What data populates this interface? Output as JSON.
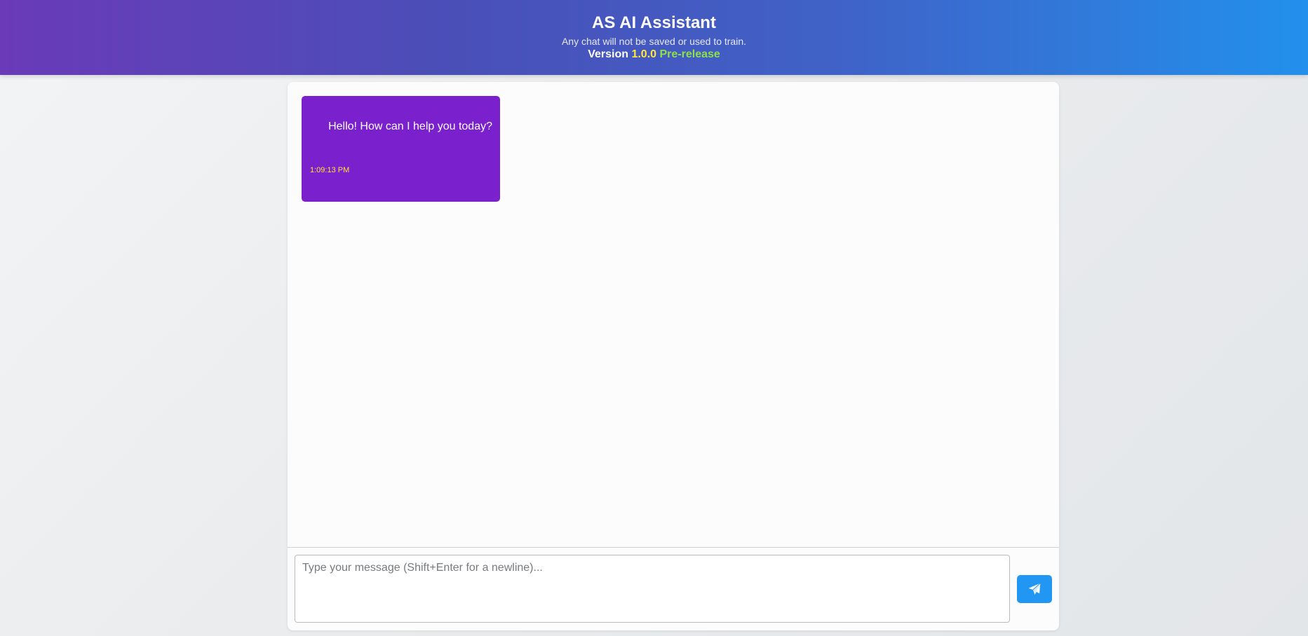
{
  "header": {
    "title": "AS AI Assistant",
    "subtitle": "Any chat will not be saved or used to train.",
    "version_label": "Version",
    "version_number": "1.0.0",
    "version_tag": "Pre-release"
  },
  "messages": [
    {
      "text": "Hello! How can I help you today?",
      "time": "1:09:13 PM"
    }
  ],
  "composer": {
    "placeholder": "Type your message (Shift+Enter for a newline)...",
    "value": "",
    "send_icon": "paper-plane-icon"
  },
  "colors": {
    "header_gradient_start": "#6a3ab8",
    "header_gradient_end": "#2290ec",
    "bubble": "#7a20cc",
    "timestamp": "#ffe23a",
    "version_number": "#ffe83a",
    "version_tag": "#8ee04a",
    "send_button": "#2196f3"
  }
}
